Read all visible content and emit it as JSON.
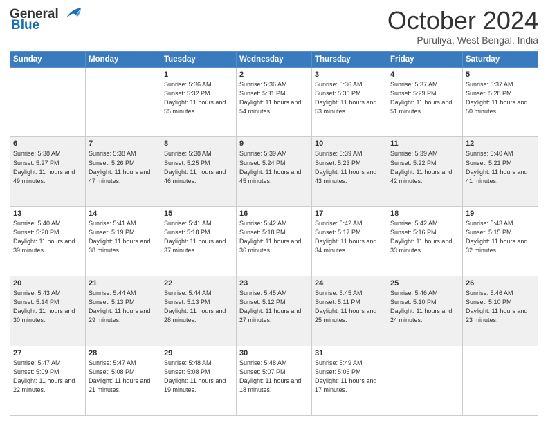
{
  "header": {
    "logo_line1": "General",
    "logo_line2": "Blue",
    "month": "October 2024",
    "location": "Puruliya, West Bengal, India"
  },
  "weekdays": [
    "Sunday",
    "Monday",
    "Tuesday",
    "Wednesday",
    "Thursday",
    "Friday",
    "Saturday"
  ],
  "rows": [
    [
      {
        "day": "",
        "sunrise": "",
        "sunset": "",
        "daylight": ""
      },
      {
        "day": "",
        "sunrise": "",
        "sunset": "",
        "daylight": ""
      },
      {
        "day": "1",
        "sunrise": "Sunrise: 5:36 AM",
        "sunset": "Sunset: 5:32 PM",
        "daylight": "Daylight: 11 hours and 55 minutes."
      },
      {
        "day": "2",
        "sunrise": "Sunrise: 5:36 AM",
        "sunset": "Sunset: 5:31 PM",
        "daylight": "Daylight: 11 hours and 54 minutes."
      },
      {
        "day": "3",
        "sunrise": "Sunrise: 5:36 AM",
        "sunset": "Sunset: 5:30 PM",
        "daylight": "Daylight: 11 hours and 53 minutes."
      },
      {
        "day": "4",
        "sunrise": "Sunrise: 5:37 AM",
        "sunset": "Sunset: 5:29 PM",
        "daylight": "Daylight: 11 hours and 51 minutes."
      },
      {
        "day": "5",
        "sunrise": "Sunrise: 5:37 AM",
        "sunset": "Sunset: 5:28 PM",
        "daylight": "Daylight: 11 hours and 50 minutes."
      }
    ],
    [
      {
        "day": "6",
        "sunrise": "Sunrise: 5:38 AM",
        "sunset": "Sunset: 5:27 PM",
        "daylight": "Daylight: 11 hours and 49 minutes."
      },
      {
        "day": "7",
        "sunrise": "Sunrise: 5:38 AM",
        "sunset": "Sunset: 5:26 PM",
        "daylight": "Daylight: 11 hours and 47 minutes."
      },
      {
        "day": "8",
        "sunrise": "Sunrise: 5:38 AM",
        "sunset": "Sunset: 5:25 PM",
        "daylight": "Daylight: 11 hours and 46 minutes."
      },
      {
        "day": "9",
        "sunrise": "Sunrise: 5:39 AM",
        "sunset": "Sunset: 5:24 PM",
        "daylight": "Daylight: 11 hours and 45 minutes."
      },
      {
        "day": "10",
        "sunrise": "Sunrise: 5:39 AM",
        "sunset": "Sunset: 5:23 PM",
        "daylight": "Daylight: 11 hours and 43 minutes."
      },
      {
        "day": "11",
        "sunrise": "Sunrise: 5:39 AM",
        "sunset": "Sunset: 5:22 PM",
        "daylight": "Daylight: 11 hours and 42 minutes."
      },
      {
        "day": "12",
        "sunrise": "Sunrise: 5:40 AM",
        "sunset": "Sunset: 5:21 PM",
        "daylight": "Daylight: 11 hours and 41 minutes."
      }
    ],
    [
      {
        "day": "13",
        "sunrise": "Sunrise: 5:40 AM",
        "sunset": "Sunset: 5:20 PM",
        "daylight": "Daylight: 11 hours and 39 minutes."
      },
      {
        "day": "14",
        "sunrise": "Sunrise: 5:41 AM",
        "sunset": "Sunset: 5:19 PM",
        "daylight": "Daylight: 11 hours and 38 minutes."
      },
      {
        "day": "15",
        "sunrise": "Sunrise: 5:41 AM",
        "sunset": "Sunset: 5:18 PM",
        "daylight": "Daylight: 11 hours and 37 minutes."
      },
      {
        "day": "16",
        "sunrise": "Sunrise: 5:42 AM",
        "sunset": "Sunset: 5:18 PM",
        "daylight": "Daylight: 11 hours and 36 minutes."
      },
      {
        "day": "17",
        "sunrise": "Sunrise: 5:42 AM",
        "sunset": "Sunset: 5:17 PM",
        "daylight": "Daylight: 11 hours and 34 minutes."
      },
      {
        "day": "18",
        "sunrise": "Sunrise: 5:42 AM",
        "sunset": "Sunset: 5:16 PM",
        "daylight": "Daylight: 11 hours and 33 minutes."
      },
      {
        "day": "19",
        "sunrise": "Sunrise: 5:43 AM",
        "sunset": "Sunset: 5:15 PM",
        "daylight": "Daylight: 11 hours and 32 minutes."
      }
    ],
    [
      {
        "day": "20",
        "sunrise": "Sunrise: 5:43 AM",
        "sunset": "Sunset: 5:14 PM",
        "daylight": "Daylight: 11 hours and 30 minutes."
      },
      {
        "day": "21",
        "sunrise": "Sunrise: 5:44 AM",
        "sunset": "Sunset: 5:13 PM",
        "daylight": "Daylight: 11 hours and 29 minutes."
      },
      {
        "day": "22",
        "sunrise": "Sunrise: 5:44 AM",
        "sunset": "Sunset: 5:13 PM",
        "daylight": "Daylight: 11 hours and 28 minutes."
      },
      {
        "day": "23",
        "sunrise": "Sunrise: 5:45 AM",
        "sunset": "Sunset: 5:12 PM",
        "daylight": "Daylight: 11 hours and 27 minutes."
      },
      {
        "day": "24",
        "sunrise": "Sunrise: 5:45 AM",
        "sunset": "Sunset: 5:11 PM",
        "daylight": "Daylight: 11 hours and 25 minutes."
      },
      {
        "day": "25",
        "sunrise": "Sunrise: 5:46 AM",
        "sunset": "Sunset: 5:10 PM",
        "daylight": "Daylight: 11 hours and 24 minutes."
      },
      {
        "day": "26",
        "sunrise": "Sunrise: 5:46 AM",
        "sunset": "Sunset: 5:10 PM",
        "daylight": "Daylight: 11 hours and 23 minutes."
      }
    ],
    [
      {
        "day": "27",
        "sunrise": "Sunrise: 5:47 AM",
        "sunset": "Sunset: 5:09 PM",
        "daylight": "Daylight: 11 hours and 22 minutes."
      },
      {
        "day": "28",
        "sunrise": "Sunrise: 5:47 AM",
        "sunset": "Sunset: 5:08 PM",
        "daylight": "Daylight: 11 hours and 21 minutes."
      },
      {
        "day": "29",
        "sunrise": "Sunrise: 5:48 AM",
        "sunset": "Sunset: 5:08 PM",
        "daylight": "Daylight: 11 hours and 19 minutes."
      },
      {
        "day": "30",
        "sunrise": "Sunrise: 5:48 AM",
        "sunset": "Sunset: 5:07 PM",
        "daylight": "Daylight: 11 hours and 18 minutes."
      },
      {
        "day": "31",
        "sunrise": "Sunrise: 5:49 AM",
        "sunset": "Sunset: 5:06 PM",
        "daylight": "Daylight: 11 hours and 17 minutes."
      },
      {
        "day": "",
        "sunrise": "",
        "sunset": "",
        "daylight": ""
      },
      {
        "day": "",
        "sunrise": "",
        "sunset": "",
        "daylight": ""
      }
    ]
  ]
}
